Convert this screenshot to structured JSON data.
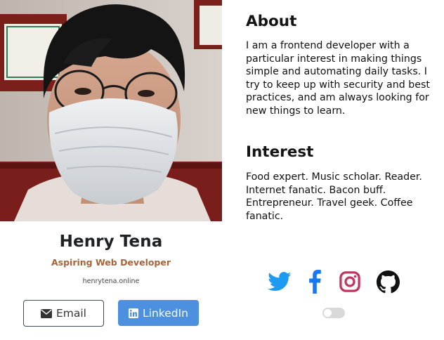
{
  "profile": {
    "name": "Henry Tena",
    "role": "Aspiring Web Developer",
    "website": "henrytena.online"
  },
  "buttons": {
    "email_label": "Email",
    "linkedin_label": "LinkedIn"
  },
  "about": {
    "heading": "About",
    "text": "I am a frontend developer with a particular interest in making things simple and automating daily tasks. I try to keep up with security and best practices, and am always looking for new things to learn."
  },
  "interest": {
    "heading": "Interest",
    "text": "Food expert. Music scholar. Reader. Internet fanatic. Bacon buff. Entrepreneur. Travel geek. Coffee fanatic."
  },
  "social": [
    "twitter-icon",
    "facebook-icon",
    "instagram-icon",
    "github-icon"
  ],
  "theme_toggle": {
    "on": false
  },
  "colors": {
    "role": "#a5663d",
    "linkedin": "#4d90e0",
    "twitter": "#1d9bf0",
    "facebook": "#1877f2",
    "instagram": "#c1355f"
  }
}
